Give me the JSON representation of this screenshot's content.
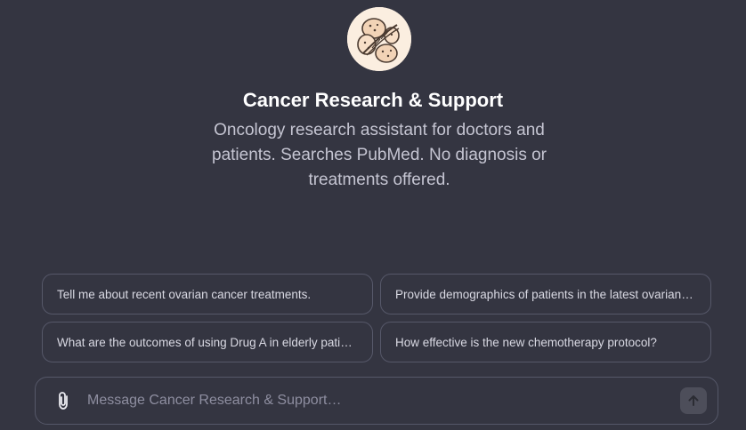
{
  "gpt": {
    "name": "Cancer Research & Support",
    "description": "Oncology research assistant for doctors and patients. Searches PubMed. No diagnosis or treatments offered.",
    "logo_icon": "cells-illustration-icon"
  },
  "suggestions": [
    {
      "label": "Tell me about recent ovarian cancer treatments."
    },
    {
      "label": "Provide demographics of patients in the latest ovarian cancer trials."
    },
    {
      "label": "What are the outcomes of using Drug A in elderly patients?"
    },
    {
      "label": "How effective is the new chemotherapy protocol?"
    }
  ],
  "composer": {
    "placeholder": "Message Cancer Research & Support…",
    "value": "",
    "attach_icon": "paperclip-icon",
    "send_icon": "arrow-up-icon"
  },
  "colors": {
    "background": "#343541",
    "title": "#ffffff",
    "description": "#c5c5d2",
    "border": "#565869",
    "logo_bg": "#fbeee0"
  }
}
